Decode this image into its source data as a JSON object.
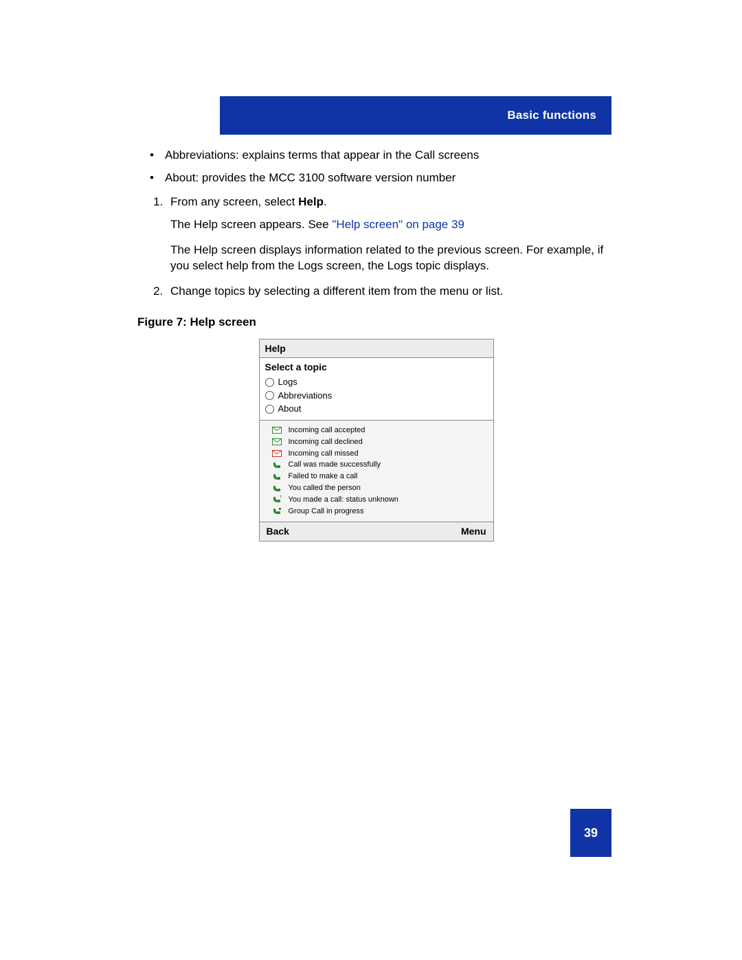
{
  "header": {
    "title": "Basic functions"
  },
  "bullets": [
    "Abbreviations: explains terms that appear in the Call screens",
    "About: provides the MCC 3100 software version number"
  ],
  "steps": {
    "s1": {
      "text_pre": "From any screen, select ",
      "text_bold": "Help",
      "text_post": ".",
      "para1_pre": "The Help screen appears. See ",
      "para1_link": "\"Help screen\" on page 39",
      "para2": "The Help screen displays information related to the previous screen. For example, if you select help from the Logs screen, the Logs topic displays."
    },
    "s2": "Change topics by selecting a different item from the menu or list."
  },
  "figure": {
    "caption": "Figure 7: Help screen"
  },
  "mockup": {
    "title": "Help",
    "topics_header": "Select a topic",
    "topics": [
      "Logs",
      "Abbreviations",
      "About"
    ],
    "legend": [
      {
        "kind": "mail-green",
        "label": "Incoming call accepted"
      },
      {
        "kind": "mail-green",
        "label": "Incoming call declined"
      },
      {
        "kind": "mail-red",
        "label": "Incoming call missed"
      },
      {
        "kind": "phone",
        "label": "Call was made successfully"
      },
      {
        "kind": "phone",
        "label": "Failed to make a call"
      },
      {
        "kind": "phone",
        "label": "You called the person"
      },
      {
        "kind": "phone-q",
        "label": "You made a call: status unknown"
      },
      {
        "kind": "phone-g",
        "label": "Group Call in progress"
      }
    ],
    "softkeys": {
      "left": "Back",
      "right": "Menu"
    }
  },
  "page_number": "39"
}
